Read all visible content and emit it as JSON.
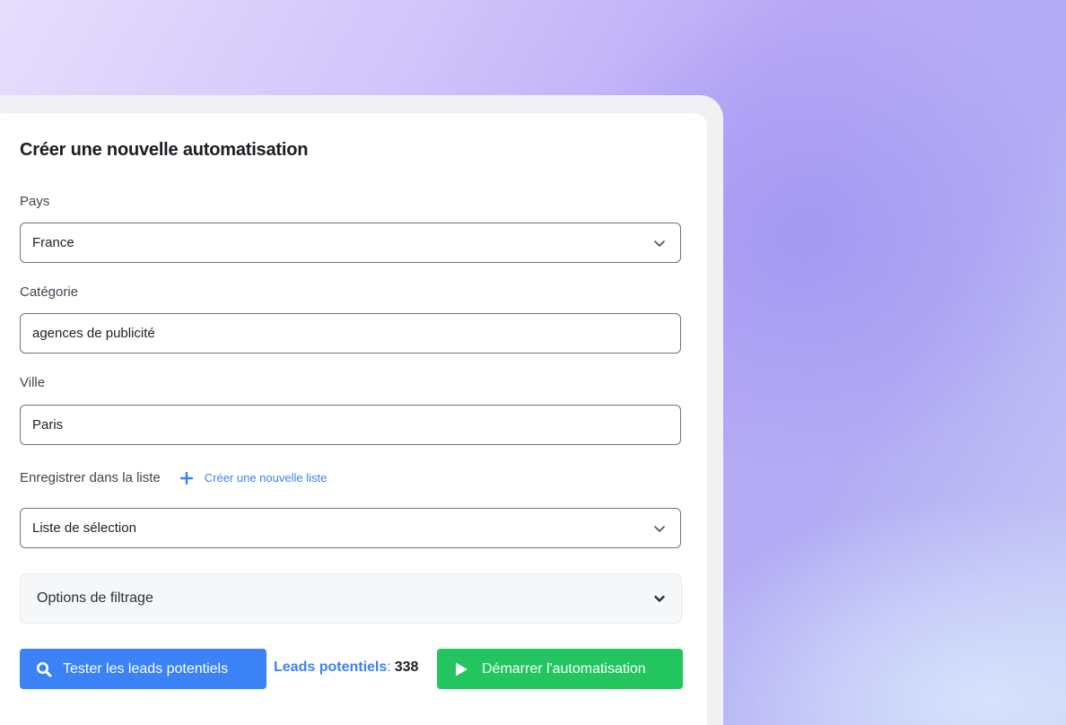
{
  "form": {
    "title": "Créer une nouvelle automatisation",
    "country": {
      "label": "Pays",
      "value": "France"
    },
    "category": {
      "label": "Catégorie",
      "value": "agences de publicité"
    },
    "city": {
      "label": "Ville",
      "value": "Paris"
    },
    "list": {
      "label": "Enregistrer dans la liste",
      "create_link": "Créer une nouvelle liste",
      "value": "Liste de sélection"
    },
    "filters": {
      "label": "Options de filtrage"
    }
  },
  "actions": {
    "test_label": "Tester les leads potentiels",
    "leads_label": "Leads potentiels",
    "leads_separator": ":",
    "leads_count": "338",
    "start_label": "Démarrer l'automatisation"
  },
  "colors": {
    "primary": "#3b82f6",
    "success": "#22c55e"
  },
  "icons": {
    "dropdown": "chevron-down-icon",
    "add": "plus-icon",
    "test": "search-icon",
    "start": "play-icon"
  }
}
